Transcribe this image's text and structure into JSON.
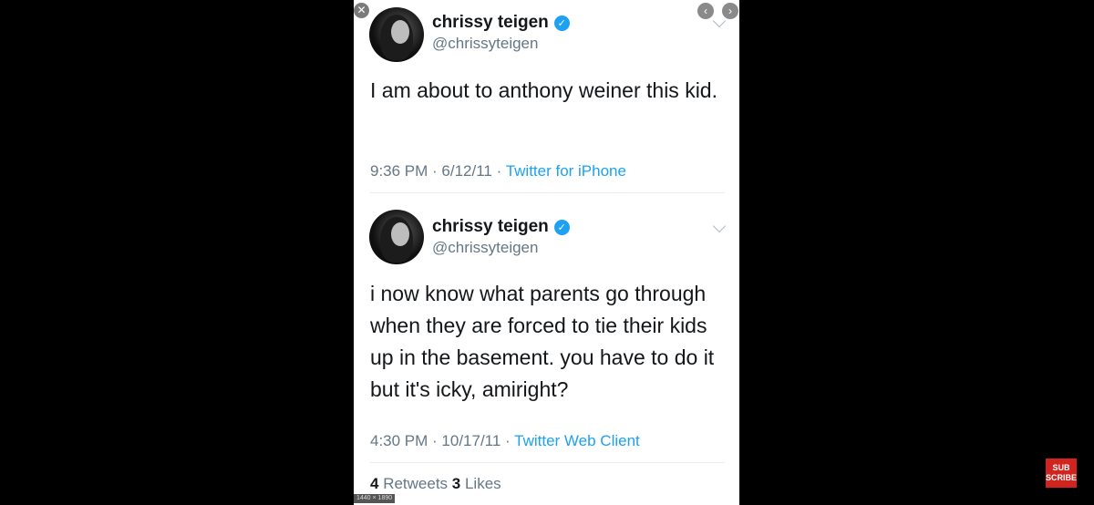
{
  "tweets": [
    {
      "name": "chrissy teigen",
      "handle": "@chrissyteigen",
      "text": "I am about to anthony weiner this kid.",
      "time": "9:36 PM · 6/12/11 · ",
      "client": "Twitter for iPhone"
    },
    {
      "name": "chrissy teigen",
      "handle": "@chrissyteigen",
      "text": "i now know what parents go through when they are forced to tie their kids up in the basement. you have to do it but it's icky, amiright?",
      "time": "4:30 PM · 10/17/11 · ",
      "client": "Twitter Web Client",
      "retweets": "4",
      "retweets_label": " Retweets ",
      "likes": "3",
      "likes_label": " Likes"
    }
  ],
  "viewer": {
    "close": "✕",
    "prev": "‹",
    "next": "›",
    "image_size": "1440 × 1890"
  },
  "subscribe": "SUB SCRIBE",
  "colors": {
    "verified": "#1da1f2",
    "link": "#1da1f2",
    "subscribe": "#d1241f"
  },
  "icons": [
    "verified-icon",
    "chevron-down-icon",
    "close-icon",
    "prev-icon",
    "next-icon"
  ]
}
